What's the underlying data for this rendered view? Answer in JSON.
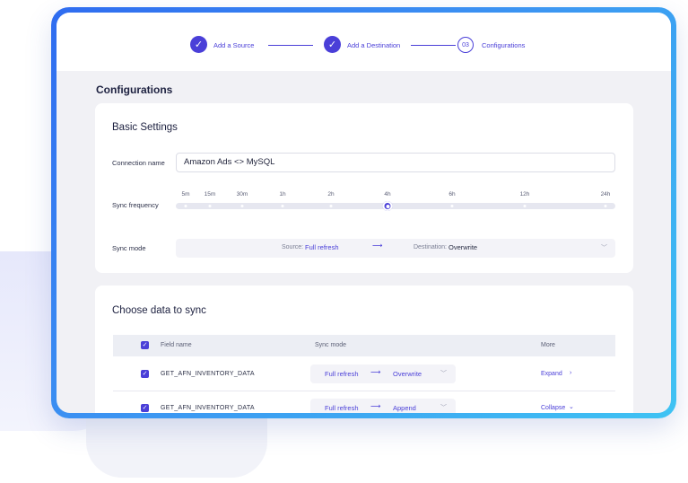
{
  "stepper": {
    "steps": [
      {
        "label": "Add a Source",
        "state": "done"
      },
      {
        "label": "Add a Destination",
        "state": "done"
      },
      {
        "label": "Configurations",
        "number": "03",
        "state": "current"
      }
    ]
  },
  "page_title": "Configurations",
  "basic_settings": {
    "title": "Basic Settings",
    "connection_name_label": "Connection name",
    "connection_name_value": "Amazon Ads <> MySQL",
    "sync_frequency_label": "Sync frequency",
    "frequency_options": [
      "5m",
      "15m",
      "30m",
      "1h",
      "2h",
      "4h",
      "6h",
      "12h",
      "24h"
    ],
    "frequency_selected": "4h",
    "sync_mode_label": "Sync mode",
    "source_prefix": "Source:",
    "source_value": "Full refresh",
    "arrow": "⟶",
    "destination_prefix": "Destination:",
    "destination_value": "Overwrite"
  },
  "choose_data": {
    "title": "Choose data to sync",
    "columns": [
      "Field name",
      "Sync mode",
      "More"
    ],
    "rows": [
      {
        "field": "GET_AFN_INVENTORY_DATA",
        "source_mode": "Full refresh",
        "dest_mode": "Overwrite",
        "more": "Expand",
        "more_icon": "chevron-right-icon"
      },
      {
        "field": "GET_AFN_INVENTORY_DATA",
        "source_mode": "Full refresh",
        "dest_mode": "Append",
        "more": "Collapse",
        "more_icon": "chevron-down-icon"
      }
    ]
  },
  "colors": {
    "accent": "#4a3fd8",
    "frame_gradient_start": "#2f6cf0",
    "frame_gradient_end": "#3fc3f3"
  }
}
